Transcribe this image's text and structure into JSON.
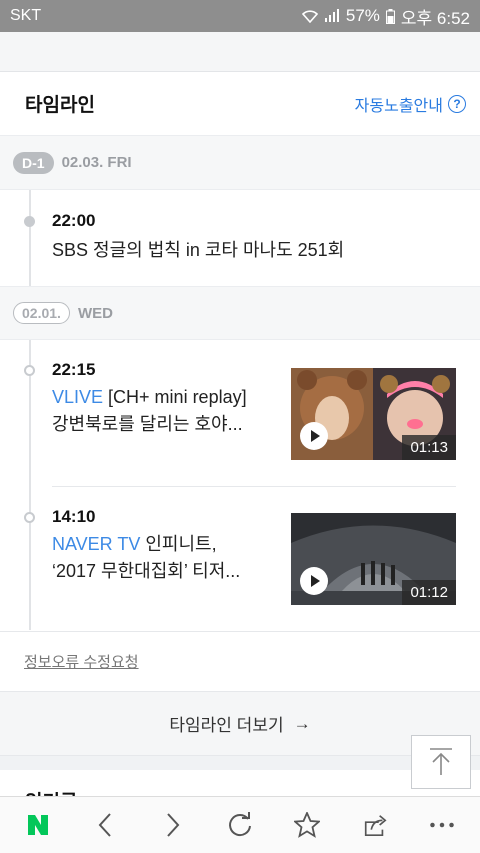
{
  "status_bar": {
    "carrier": "SKT",
    "battery": "57%",
    "time": "오후 6:52"
  },
  "timeline": {
    "title": "타임라인",
    "notice_label": "자동노출안내",
    "help_symbol": "?",
    "groups": [
      {
        "badge": "D-1",
        "date": "02.03. FRI",
        "items": [
          {
            "time": "22:00",
            "text": "SBS 정글의 법칙 in 코타 마나도 251회"
          }
        ]
      },
      {
        "badge": "02.01.",
        "date": "WED",
        "items": [
          {
            "time": "22:15",
            "source": "VLIVE",
            "line1": "[CH+ mini replay]",
            "line2": "강변북로를 달리는 호야...",
            "duration": "01:13"
          },
          {
            "time": "14:10",
            "source": "NAVER TV",
            "line1": "인피니트,",
            "line2": "‘2017 무한대집회’ 티저...",
            "duration": "01:12"
          }
        ]
      }
    ],
    "report_label": "정보오류 수정요청",
    "more_label": "타임라인 더보기",
    "more_arrow": "→"
  },
  "next_section_title": "인기글",
  "icons": {
    "naver": "naver-logo-icon",
    "back": "chevron-left-icon",
    "forward": "chevron-right-icon",
    "refresh": "refresh-icon",
    "bookmark": "star-icon",
    "share": "share-icon",
    "more": "more-icon"
  },
  "colors": {
    "accent": "#2a7be0",
    "naver_green": "#03c75a"
  }
}
